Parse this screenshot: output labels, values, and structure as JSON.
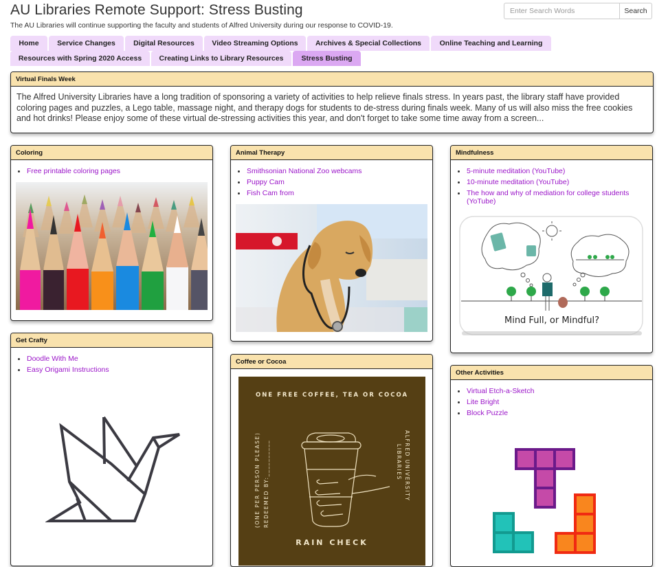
{
  "header": {
    "title": "AU Libraries Remote Support: Stress Busting",
    "subtitle": "The AU Libraries will continue supporting the faculty and students of Alfred University during our response to COVID-19."
  },
  "search": {
    "placeholder": "Enter Search Words",
    "value": "",
    "button_label": "Search"
  },
  "tabs": [
    {
      "label": "Home",
      "active": false
    },
    {
      "label": "Service Changes",
      "active": false
    },
    {
      "label": "Digital Resources",
      "active": false
    },
    {
      "label": "Video Streaming Options",
      "active": false
    },
    {
      "label": "Archives & Special Collections",
      "active": false
    },
    {
      "label": "Online Teaching and Learning",
      "active": false
    },
    {
      "label": "Resources with Spring 2020 Access",
      "active": false
    },
    {
      "label": "Creating Links to Library Resources",
      "active": false
    },
    {
      "label": "Stress Busting",
      "active": true
    }
  ],
  "intro": {
    "heading": "Virtual Finals Week",
    "text": "The Alfred University Libraries have a long tradition of sponsoring a variety of activities to help relieve finals stress.  In years past, the library staff have provided coloring pages and puzzles, a Lego table, massage night, and therapy dogs for students to de-stress during finals week.  Many of us will also miss the free cookies and hot drinks! Please enjoy some of these virtual de-stressing activities this year, and don't forget to take some time away from a screen..."
  },
  "boxes": {
    "coloring": {
      "heading": "Coloring",
      "links": [
        "Free printable coloring pages"
      ],
      "image": "colored-pencils-photo"
    },
    "animal_therapy": {
      "heading": "Animal Therapy",
      "links": [
        "Smithsonian National Zoo webcams",
        "Puppy Cam",
        "Fish Cam from"
      ],
      "image": "puppy-with-stethoscope-photo"
    },
    "mindfulness": {
      "heading": "Mindfulness",
      "links": [
        "5-minute meditation (YouTube)",
        "10-minute meditation (YouTube)",
        "The how and why of mediation for college students (YoTube)"
      ],
      "image_caption": "Mind Full, or Mindful?"
    },
    "get_crafty": {
      "heading": "Get Crafty",
      "links": [
        "Doodle With Me",
        "Easy Origami Instructions"
      ],
      "image": "origami-bird-icon"
    },
    "coffee": {
      "heading": "Coffee or Cocoa",
      "card": {
        "top": "ONE FREE COFFEE, TEA OR COCOA",
        "left_line1": "(ONE PER PERSON PLEASE)",
        "left_line2": "REDEEMED BY:__________",
        "right_line1": "ALFRED UNIVERSITY",
        "right_line2": "LIBRARIES",
        "bottom": "RAIN CHECK"
      }
    },
    "other": {
      "heading": "Other Activities",
      "links": [
        "Virtual Etch-a-Sketch",
        "Lite Bright",
        "Block Puzzle"
      ],
      "image": "tetris-blocks-icon"
    }
  },
  "colors": {
    "tab": "#f0dafa",
    "tab_active": "#dba8f2",
    "box_header": "#f9e2ad",
    "link": "#9b16c9",
    "coffee_card": "#553f14"
  }
}
